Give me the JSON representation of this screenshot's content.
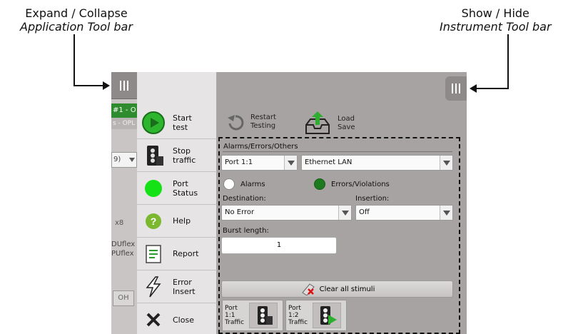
{
  "callouts": {
    "left": {
      "line1": "Expand / Collapse",
      "line2": "Application Tool bar"
    },
    "right": {
      "line1": "Show / Hide",
      "line2": "Instrument Tool bar"
    }
  },
  "background_window": {
    "green_tag": "#1 - O",
    "grey_tag": "s - OPL",
    "select_value": "9)",
    "x8_label": "x8",
    "duflex_line1": "DUflex",
    "duflex_line2": "PUflex",
    "oh_label": "OH"
  },
  "side_menu": {
    "items": [
      {
        "label": "Start\ntest",
        "icon": "play-icon"
      },
      {
        "label": "Stop\ntraffic",
        "icon": "traffic-light-icon"
      },
      {
        "label": "Port\nStatus",
        "icon": "status-led-icon"
      },
      {
        "label": "Help",
        "icon": "help-icon"
      },
      {
        "label": "Report",
        "icon": "report-icon"
      },
      {
        "label": "Error\nInsert",
        "icon": "lightning-icon"
      },
      {
        "label": "Close",
        "icon": "close-icon"
      }
    ]
  },
  "toolbar": {
    "restart_label": "Restart\nTesting",
    "loadsave_label": "Load\nSave"
  },
  "panel": {
    "section_title": "Alarms/Errors/Others",
    "port_select": "Port 1:1",
    "layer_select": "Ethernet LAN",
    "radio_alarms": "Alarms",
    "radio_errors": "Errors/Violations",
    "radio_selected": "Errors/Violations",
    "destination_label": "Destination:",
    "destination_value": "No Error",
    "insertion_label": "Insertion:",
    "insertion_value": "Off",
    "burst_label": "Burst length:",
    "burst_value": "1",
    "clear_label": "Clear all stimuli"
  },
  "traffic_buttons": [
    {
      "label": "Port\n1:1\nTraffic",
      "state": "stopped"
    },
    {
      "label": "Port\n1:2\nTraffic",
      "state": "running"
    }
  ],
  "colors": {
    "green": "#1e7a1e",
    "window_grey": "#a8a3a3",
    "menu_bg": "#e6e4e4"
  }
}
